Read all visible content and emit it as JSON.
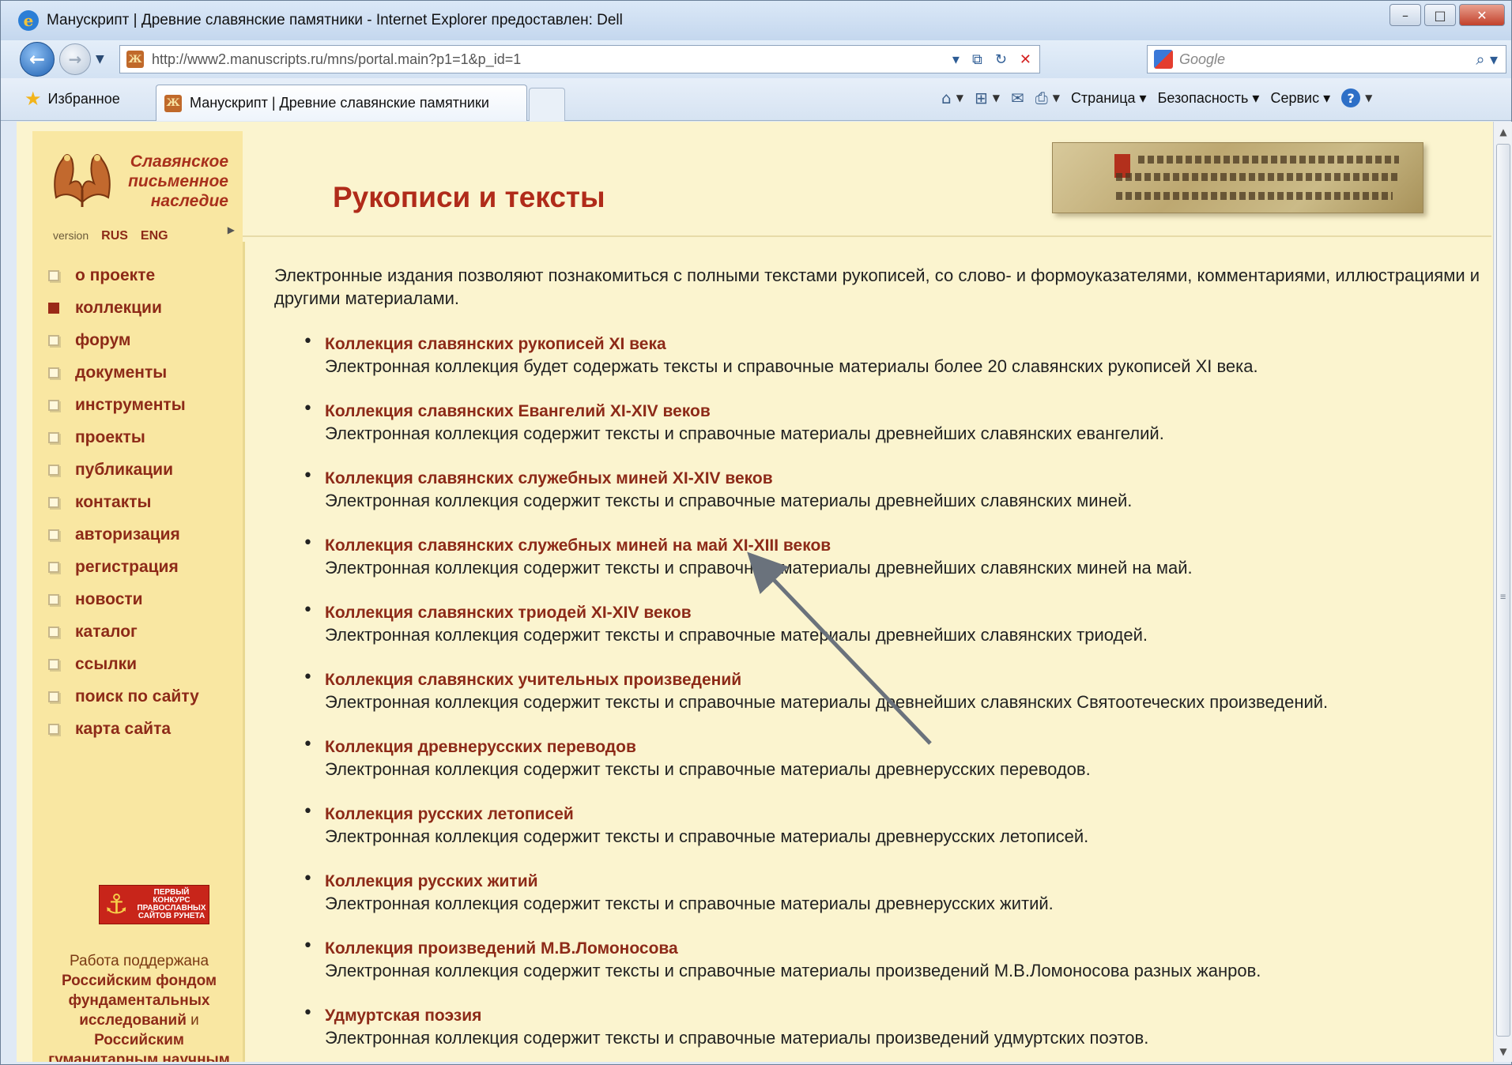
{
  "browser": {
    "window_title": "Манускрипт | Древние славянские памятники - Internet Explorer предоставлен: Dell",
    "url": "http://www2.manuscripts.ru/mns/portal.main?p1=1&p_id=1",
    "search_placeholder": "Google",
    "favorites_label": "Избранное",
    "tab_title": "Манускрипт | Древние славянские памятники",
    "commands": {
      "page": "Страница",
      "safety": "Безопасность",
      "service": "Сервис"
    }
  },
  "site": {
    "name_line1": "Славянское",
    "name_line2": "письменное",
    "name_line3": "наследие",
    "version_label": "version",
    "lang_rus": "RUS",
    "lang_eng": "ENG",
    "page_title": "Рукописи и тексты"
  },
  "nav": [
    {
      "label": "о проекте",
      "active": false
    },
    {
      "label": "коллекции",
      "active": true
    },
    {
      "label": "форум",
      "active": false
    },
    {
      "label": "документы",
      "active": false
    },
    {
      "label": "инструменты",
      "active": false
    },
    {
      "label": "проекты",
      "active": false
    },
    {
      "label": "публикации",
      "active": false
    },
    {
      "label": "контакты",
      "active": false
    },
    {
      "label": "авторизация",
      "active": false
    },
    {
      "label": "регистрация",
      "active": false
    },
    {
      "label": "новости",
      "active": false
    },
    {
      "label": "каталог",
      "active": false
    },
    {
      "label": "ссылки",
      "active": false
    },
    {
      "label": "поиск по сайту",
      "active": false
    },
    {
      "label": "карта сайта",
      "active": false
    }
  ],
  "award": {
    "text": "Первый конкурс православных сайтов Рунета"
  },
  "support": {
    "line1": "Работа поддержана",
    "bold": "Российским фондом фундаментальных исследований",
    "and": "и",
    "bold2": "Российским гуманитарным научным фондом",
    "end": "."
  },
  "intro": "Электронные издания позволяют познакомиться с полными текстами рукописей, со слово- и формоуказателями, комментариями, иллюстрациями и другими материалами.",
  "collections": [
    {
      "title": "Коллекция славянских рукописей XI века",
      "desc": "Электронная коллекция будет содержать тексты и справочные материалы более 20 славянских рукописей XI века."
    },
    {
      "title": "Коллекция славянских Евангелий XI-XIV веков",
      "desc": "Электронная коллекция содержит тексты и справочные материалы древнейших славянских евангелий."
    },
    {
      "title": "Коллекция славянских служебных миней XI-XIV веков",
      "desc": "Электронная коллекция содержит тексты и справочные материалы древнейших славянских миней."
    },
    {
      "title": "Коллекция славянских служебных миней на май XI-XIII веков",
      "desc": "Электронная коллекция содержит тексты и справочные материалы древнейших славянских миней на май."
    },
    {
      "title": "Коллекция славянских триодей XI-XIV веков",
      "desc": "Электронная коллекция содержит тексты и справочные материалы древнейших славянских триодей."
    },
    {
      "title": "Коллекция славянских учительных произведений",
      "desc": "Электронная коллекция содержит тексты и справочные материалы древнейших славянских Святоотеческих произведений."
    },
    {
      "title": "Коллекция древнерусских переводов",
      "desc": "Электронная коллекция содержит тексты и справочные материалы древнерусских переводов."
    },
    {
      "title": "Коллекция русских летописей",
      "desc": "Электронная коллекция содержит тексты и справочные материалы древнерусских летописей."
    },
    {
      "title": "Коллекция русских житий",
      "desc": "Электронная коллекция содержит тексты и справочные материалы древнерусских житий."
    },
    {
      "title": "Коллекция произведений М.В.Ломоносова",
      "desc": "Электронная коллекция содержит тексты и справочные материалы произведений М.В.Ломоносова разных жанров."
    },
    {
      "title": "Удмуртская поэзия",
      "desc": "Электронная коллекция содержит тексты и справочные материалы произведений удмуртских поэтов."
    }
  ],
  "colors": {
    "accent_red": "#b02b1a",
    "link_brown": "#8d2a18",
    "page_bg": "#fbf4cf",
    "sidebar_bg": "#f9e7a2"
  }
}
